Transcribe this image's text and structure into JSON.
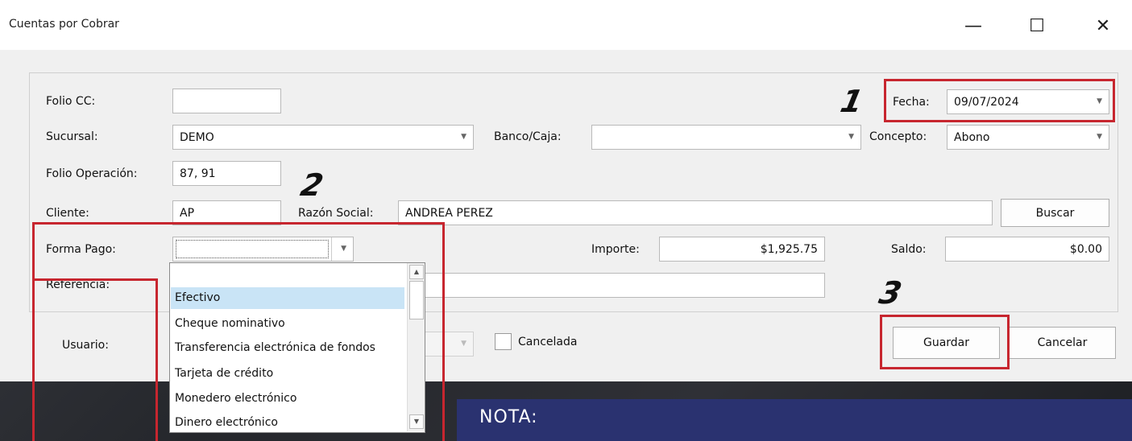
{
  "window": {
    "title": "Cuentas por Cobrar",
    "controls": {
      "minimize": "—",
      "maximize": "☐",
      "close": "✕"
    }
  },
  "form": {
    "folio_cc": {
      "label": "Folio CC:",
      "value": ""
    },
    "fecha": {
      "label": "Fecha:",
      "value": "09/07/2024"
    },
    "sucursal": {
      "label": "Sucursal:",
      "value": "DEMO"
    },
    "banco_caja": {
      "label": "Banco/Caja:",
      "value": ""
    },
    "concepto": {
      "label": "Concepto:",
      "value": "Abono"
    },
    "folio_operacion": {
      "label": "Folio Operación:",
      "value": "87, 91"
    },
    "cliente": {
      "label": "Cliente:",
      "value": "AP"
    },
    "razon_social": {
      "label": "Razón Social:",
      "value": "ANDREA PEREZ"
    },
    "buscar_label": "Buscar",
    "forma_pago": {
      "label": "Forma Pago:",
      "value": ""
    },
    "importe": {
      "label": "Importe:",
      "value": "$1,925.75"
    },
    "saldo": {
      "label": "Saldo:",
      "value": "$0.00"
    },
    "referencia": {
      "label": "Referencia:",
      "value": ""
    }
  },
  "footer": {
    "usuario_label": "Usuario:",
    "cancelada_label": "Cancelada",
    "guardar_label": "Guardar",
    "cancelar_label": "Cancelar"
  },
  "dropdown": {
    "options": [
      "",
      "Efectivo",
      "Cheque nominativo",
      "Transferencia electrónica de fondos",
      "Tarjeta de crédito",
      "Monedero electrónico",
      "Dinero electrónico"
    ],
    "selected": "Efectivo"
  },
  "annotations": {
    "marker1": "1",
    "marker2": "2",
    "marker3": "3",
    "nota": "NOTA:"
  },
  "colors": {
    "highlight_red": "#c7262f",
    "selection_blue": "#c9e4f6",
    "nota_bg": "#2a3270"
  }
}
